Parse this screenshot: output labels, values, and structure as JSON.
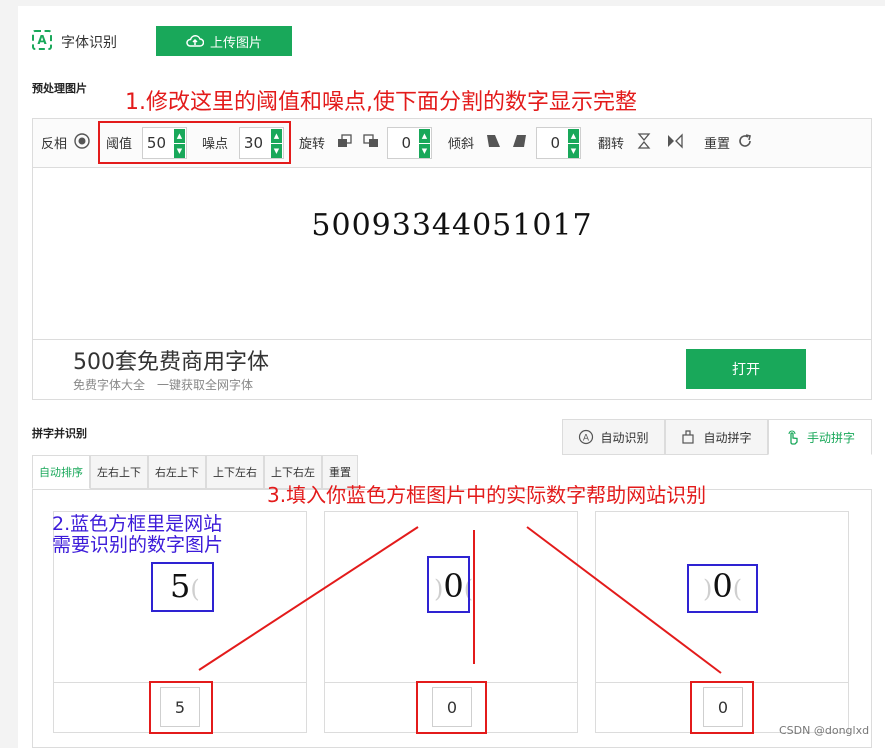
{
  "header": {
    "brand_label": "字体识别",
    "upload_label": "上传图片"
  },
  "preprocess": {
    "title": "预处理图片",
    "invert_label": "反相",
    "threshold_label": "阈值",
    "threshold_value": "50",
    "noise_label": "噪点",
    "noise_value": "30",
    "rotate_label": "旋转",
    "rotate_value": "0",
    "skew_label": "倾斜",
    "skew_value": "0",
    "flip_label": "翻转",
    "reset_label": "重置",
    "preview_text": "50093344051017"
  },
  "ad": {
    "title": "500套免费商用字体",
    "subtitle": "免费字体大全　一键获取全网字体",
    "open_label": "打开"
  },
  "compose": {
    "title": "拼字并识别",
    "mode_tabs": [
      "自动识别",
      "自动拼字",
      "手动拼字"
    ],
    "sort_tabs": [
      "自动排序",
      "左右上下",
      "右左上下",
      "上下左右",
      "上下右左",
      "重置"
    ],
    "cards": [
      {
        "glyph": "5",
        "ghost": "(",
        "ghost_left": "",
        "answer": "5"
      },
      {
        "glyph": "0",
        "ghost": "(",
        "ghost_left": ")",
        "answer": "0"
      },
      {
        "glyph": "0",
        "ghost": "(",
        "ghost_left": ")",
        "answer": "0"
      }
    ]
  },
  "annotations": {
    "step1": "1.修改这里的阈值和噪点,使下面分割的数字显示完整",
    "step2_line1": "2.蓝色方框里是网站",
    "step2_line2": "需要识别的数字图片",
    "step3": "3.填入你蓝色方框图片中的实际数字帮助网站识别"
  },
  "watermark": "CSDN @donglxd",
  "colors": {
    "accent": "#19a85a",
    "annotation_red": "#e31b1b",
    "annotation_blue": "#2e23d2"
  }
}
